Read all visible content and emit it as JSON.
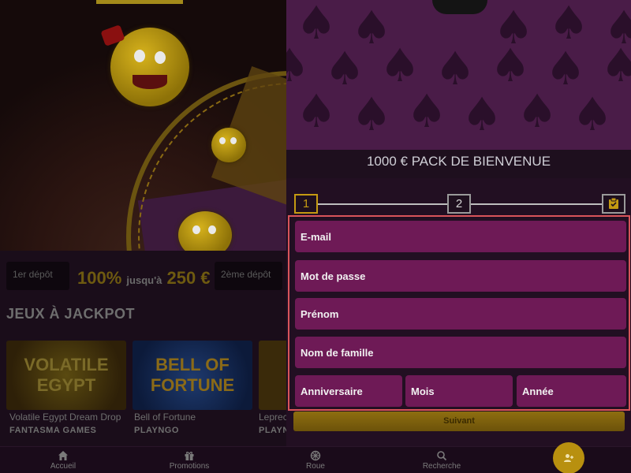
{
  "left": {
    "deposit": {
      "first_label": "1er dépôt",
      "promo_big": "100%",
      "promo_small": "jusqu'à",
      "promo_amount": "250 €",
      "second_label": "2ème dépôt"
    },
    "jackpot_title": "JEUX À JACKPOT",
    "games": [
      {
        "art": "VOLATILE EGYPT",
        "title": "Volatile Egypt Dream Drop",
        "provider": "FANTASMA GAMES"
      },
      {
        "art": "BELL OF FORTUNE",
        "title": "Bell of Fortune",
        "provider": "PLAYNGO"
      },
      {
        "art": "",
        "title": "Leprec",
        "provider": "PLAYN"
      }
    ]
  },
  "panel": {
    "title": "1000 € PACK DE BIENVENUE",
    "steps": [
      "1",
      "2"
    ],
    "fields": {
      "email": "E-mail",
      "password": "Mot de passe",
      "first_name": "Prénom",
      "last_name": "Nom de famille",
      "birthday": "Anniversaire",
      "month": "Mois",
      "year": "Année"
    },
    "next_label": "Suivant"
  },
  "nav": [
    {
      "label": "Accueil",
      "icon": "home-icon"
    },
    {
      "label": "Promotions",
      "icon": "gift-icon"
    },
    {
      "label": "Roue",
      "icon": "wheel-icon"
    },
    {
      "label": "Recherche",
      "icon": "search-icon"
    },
    {
      "label": "",
      "icon": "add-user-icon"
    }
  ],
  "colors": {
    "accent_gold": "#c49a12",
    "field_bg": "#6e1a56",
    "highlight_border": "#d8545a"
  }
}
